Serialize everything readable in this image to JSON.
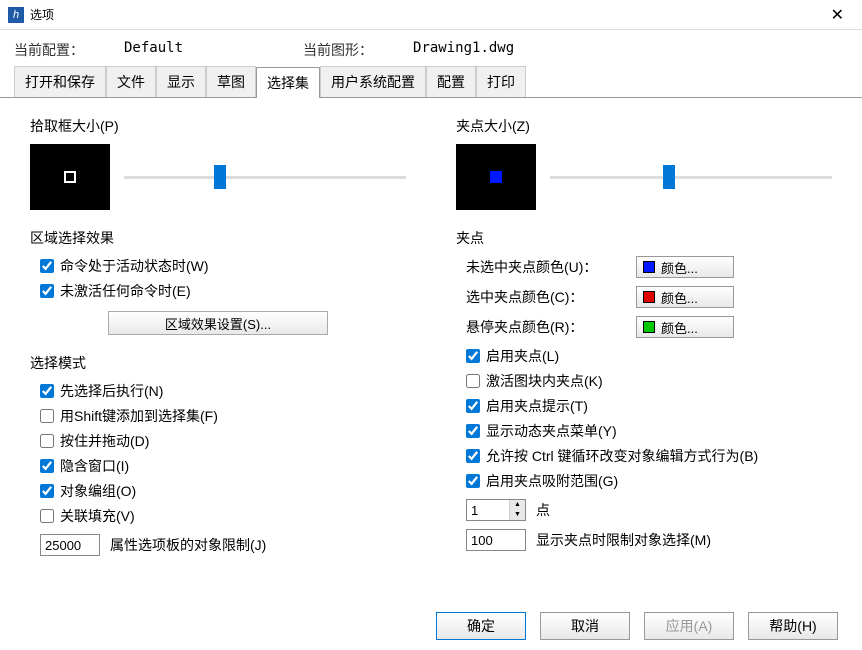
{
  "window": {
    "title": "选项"
  },
  "header": {
    "config_label": "当前配置：",
    "config_value": "Default",
    "drawing_label": "当前图形：",
    "drawing_value": "Drawing1.dwg"
  },
  "tabs": [
    "打开和保存",
    "文件",
    "显示",
    "草图",
    "选择集",
    "用户系统配置",
    "配置",
    "打印"
  ],
  "active_tab": "选择集",
  "pickbox": {
    "title": "拾取框大小(P)"
  },
  "grip_size": {
    "title": "夹点大小(Z)"
  },
  "area_effect": {
    "title": "区域选择效果",
    "check_active": "命令处于活动状态时(W)",
    "check_inactive": "未激活任何命令时(E)",
    "settings_btn": "区域效果设置(S)..."
  },
  "select_mode": {
    "title": "选择模式",
    "preselect": "先选择后执行(N)",
    "shift_add": "用Shift键添加到选择集(F)",
    "press_drag": "按住并拖动(D)",
    "implied_window": "隐含窗口(I)",
    "object_group": "对象编组(O)",
    "assoc_hatch": "关联填充(V)",
    "limit_value": "25000",
    "limit_label": "属性选项板的对象限制(J)"
  },
  "grips": {
    "title": "夹点",
    "unselected_label": "未选中夹点颜色(U)：",
    "selected_label": "选中夹点颜色(C)：",
    "hover_label": "悬停夹点颜色(R)：",
    "color_btn_text": "颜色...",
    "unselected_color": "#0018ff",
    "selected_color": "#e00000",
    "hover_color": "#00c800",
    "enable_grips": "启用夹点(L)",
    "block_grips": "激活图块内夹点(K)",
    "grip_tips": "启用夹点提示(T)",
    "dyn_menu": "显示动态夹点菜单(Y)",
    "ctrl_cycle": "允许按 Ctrl 键循环改变对象编辑方式行为(B)",
    "snap_range": "启用夹点吸附范围(G)",
    "snap_value": "1",
    "snap_unit": "点",
    "limit_value": "100",
    "limit_label": "显示夹点时限制对象选择(M)"
  },
  "buttons": {
    "ok": "确定",
    "cancel": "取消",
    "apply": "应用(A)",
    "help": "帮助(H)"
  }
}
